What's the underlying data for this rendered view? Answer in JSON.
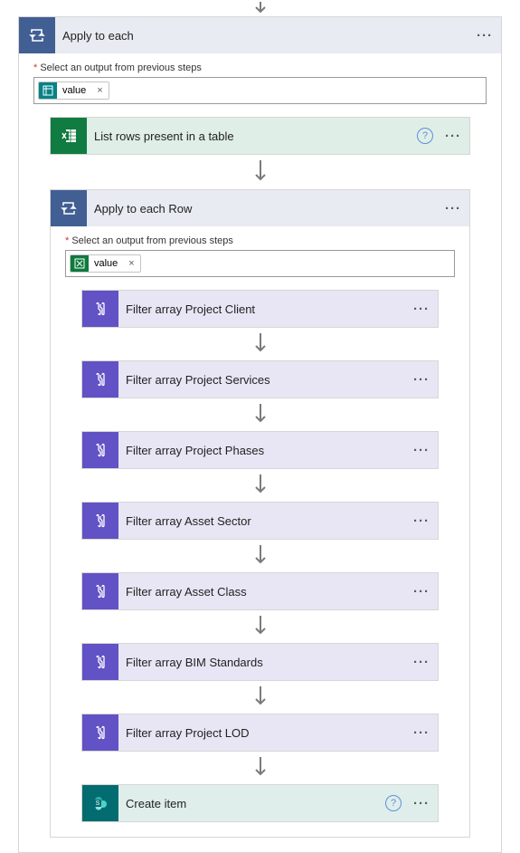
{
  "labels": {
    "selectOutput": "Select an output from previous steps",
    "req": "*"
  },
  "tokens": {
    "value": "value"
  },
  "outer": {
    "title": "Apply to each"
  },
  "inner": {
    "title": "Apply to each Row"
  },
  "actions": {
    "listRows": "List rows present in a table",
    "createItem": "Create item",
    "filters": [
      "Filter array Project Client",
      "Filter array Project Services",
      "Filter array Project Phases",
      "Filter array Asset Sector",
      "Filter array Asset Class",
      "Filter array BIM Standards",
      "Filter array Project LOD"
    ]
  }
}
